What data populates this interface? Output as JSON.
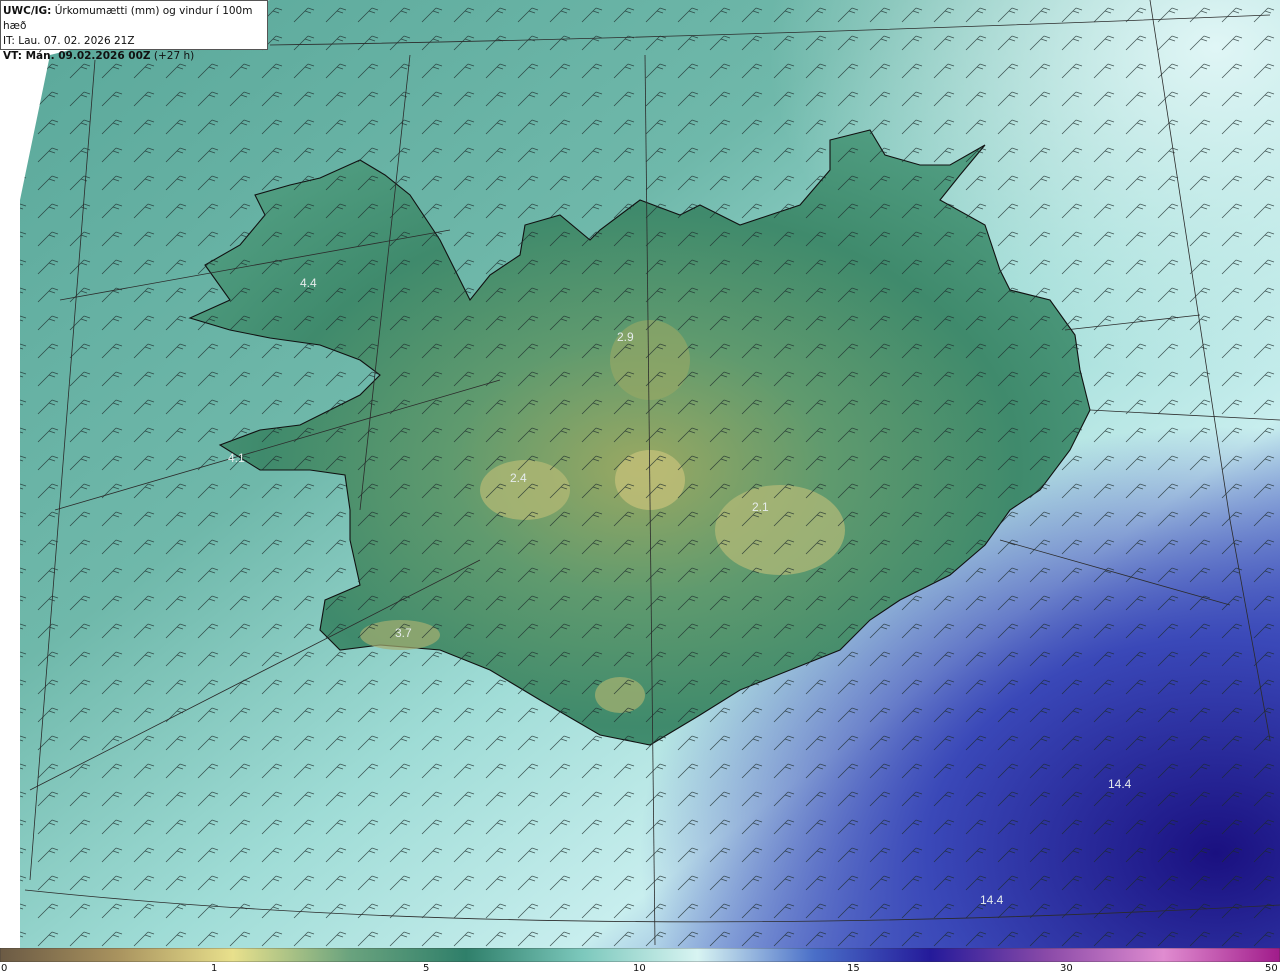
{
  "header": {
    "product_code": "UWC/IG:",
    "product_desc": "Úrkomumætti (mm) og vindur í 100m hæð",
    "issue_time": "IT: Lau. 07. 02. 2026 21Z",
    "valid_prefix": "VT: Mán. 09.02.2026 00Z",
    "valid_suffix": "(+27 h)"
  },
  "map_labels": [
    {
      "text": "4.4",
      "region": "westfjords"
    },
    {
      "text": "2.9",
      "region": "north"
    },
    {
      "text": "4.1",
      "region": "snaefellsnes"
    },
    {
      "text": "2.4",
      "region": "west-highlands"
    },
    {
      "text": "2.1",
      "region": "vatnajokull"
    },
    {
      "text": "3.7",
      "region": "reykjanes"
    },
    {
      "text": "14.4",
      "region": "southeast-ocean-1"
    },
    {
      "text": "14.4",
      "region": "southeast-ocean-2"
    }
  ],
  "colorbar": {
    "ticks": [
      "0",
      "1",
      "5",
      "10",
      "15",
      "30",
      "50"
    ],
    "colors": [
      "#6b5a44",
      "#a8925e",
      "#e8e08c",
      "#6aa37e",
      "#2f7f6a",
      "#7cc8bc",
      "#d8f4f2",
      "#4a6fc8",
      "#241a9a",
      "#8a4aa8",
      "#e08cd0",
      "#a01b8a"
    ]
  }
}
